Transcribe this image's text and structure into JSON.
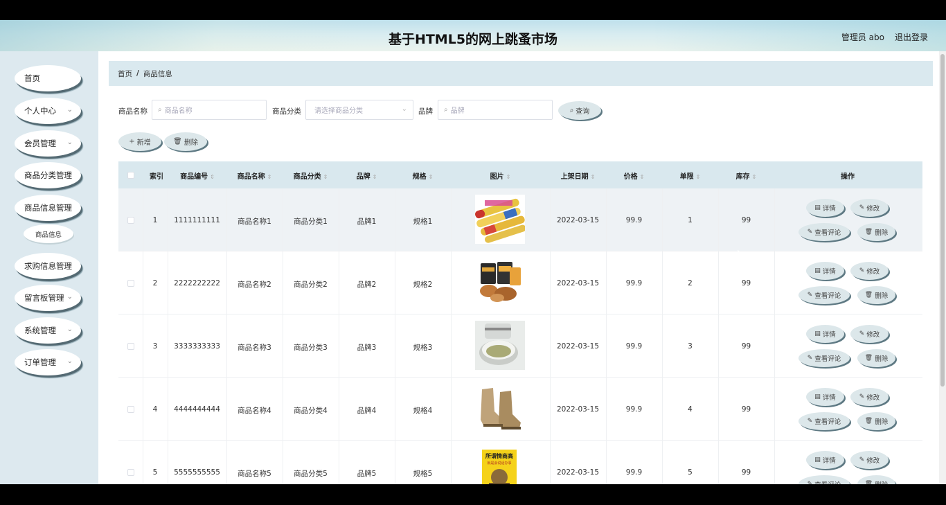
{
  "header": {
    "title": "基于HTML5的网上跳蚤市场",
    "user_label": "管理员 abo",
    "logout_label": "退出登录"
  },
  "sidebar": {
    "items": [
      {
        "label": "首页",
        "has_arrow": false
      },
      {
        "label": "个人中心",
        "has_arrow": true
      },
      {
        "label": "会员管理",
        "has_arrow": true
      },
      {
        "label": "商品分类管理",
        "has_arrow": true
      },
      {
        "label": "商品信息管理",
        "has_arrow": true
      },
      {
        "label": "求购信息管理",
        "has_arrow": true
      },
      {
        "label": "留言板管理",
        "has_arrow": true
      },
      {
        "label": "系统管理",
        "has_arrow": true
      },
      {
        "label": "订单管理",
        "has_arrow": true
      }
    ],
    "sub_item": "商品信息"
  },
  "breadcrumb": {
    "home": "首页",
    "separator": "/",
    "current": "商品信息"
  },
  "filters": {
    "name_label": "商品名称",
    "name_placeholder": "商品名称",
    "category_label": "商品分类",
    "category_placeholder": "请选择商品分类",
    "brand_label": "品牌",
    "brand_placeholder": "品牌",
    "search_label": "查询"
  },
  "actions": {
    "add_label": "新增",
    "delete_label": "删除"
  },
  "table": {
    "headers": [
      "索引",
      "商品编号",
      "商品名称",
      "商品分类",
      "品牌",
      "规格",
      "图片",
      "上架日期",
      "价格",
      "单限",
      "库存",
      "操作"
    ],
    "op_labels": {
      "detail": "详情",
      "edit": "修改",
      "comments": "查看评论",
      "delete": "删除"
    },
    "rows": [
      {
        "index": "1",
        "code": "1111111111",
        "name": "商品名称1",
        "category": "商品分类1",
        "brand": "品牌1",
        "spec": "规格1",
        "image": "snack-rolls",
        "date": "2022-03-15",
        "price": "99.9",
        "limit": "1",
        "stock": "99"
      },
      {
        "index": "2",
        "code": "2222222222",
        "name": "商品名称2",
        "category": "商品分类2",
        "brand": "品牌2",
        "spec": "规格2",
        "image": "packaged-snacks",
        "date": "2022-03-15",
        "price": "99.9",
        "limit": "2",
        "stock": "99"
      },
      {
        "index": "3",
        "code": "3333333333",
        "name": "商品名称3",
        "category": "商品分类3",
        "brand": "品牌3",
        "spec": "规格3",
        "image": "cream-jar",
        "date": "2022-03-15",
        "price": "99.9",
        "limit": "3",
        "stock": "99"
      },
      {
        "index": "4",
        "code": "4444444444",
        "name": "商品名称4",
        "category": "商品分类4",
        "brand": "品牌4",
        "spec": "规格4",
        "image": "boots",
        "date": "2022-03-15",
        "price": "99.9",
        "limit": "4",
        "stock": "99"
      },
      {
        "index": "5",
        "code": "5555555555",
        "name": "商品名称5",
        "category": "商品分类5",
        "brand": "品牌5",
        "spec": "规格5",
        "image": "book",
        "date": "2022-03-15",
        "price": "99.9",
        "limit": "5",
        "stock": "99"
      }
    ],
    "book_cover_text": "所谓情商高 就是会说话办事"
  },
  "colors": {
    "accent_bg": "#dae9ef",
    "button_bg": "#dce7ea",
    "button_shadow": "#5e7983"
  }
}
